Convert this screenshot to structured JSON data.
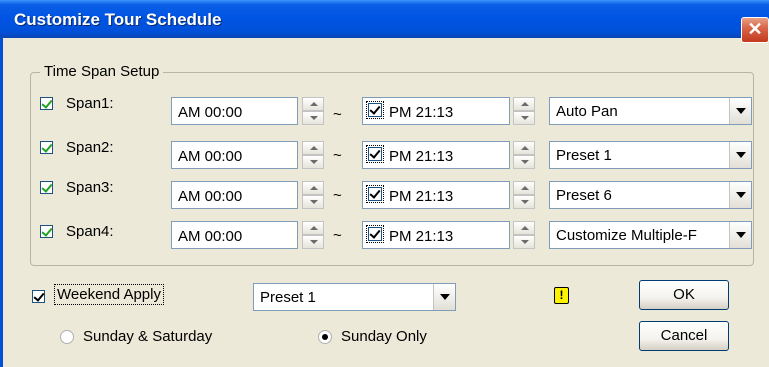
{
  "window": {
    "title": "Customize Tour Schedule",
    "close_glyph": "✕"
  },
  "group": {
    "legend": "Time Span Setup"
  },
  "spans": [
    {
      "label": "Span1:",
      "start": "AM 00:00",
      "separator": "~",
      "end": "PM 21:13",
      "action": "Auto Pan"
    },
    {
      "label": "Span2:",
      "start": "AM 00:00",
      "separator": "~",
      "end": "PM 21:13",
      "action": "Preset 1"
    },
    {
      "label": "Span3:",
      "start": "AM 00:00",
      "separator": "~",
      "end": "PM 21:13",
      "action": "Preset 6"
    },
    {
      "label": "Span4:",
      "start": "AM 00:00",
      "separator": "~",
      "end": "PM 21:13",
      "action": "Customize Multiple-F"
    }
  ],
  "weekend": {
    "label": "Weekend Apply",
    "preset": "Preset 1",
    "option_1": "Sunday & Saturday",
    "option_2": "Sunday Only",
    "selected": "Sunday Only",
    "warning_glyph": "!"
  },
  "buttons": {
    "ok": "OK",
    "cancel": "Cancel"
  },
  "colors": {
    "title_bar": "#0054E3",
    "dialog_bg": "#ECE9D8",
    "check_green": "#21A121",
    "warning": "#FFF200"
  }
}
